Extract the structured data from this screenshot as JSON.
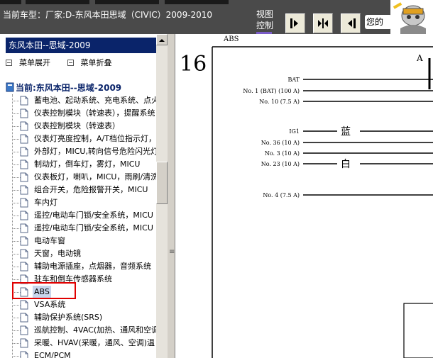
{
  "window": {
    "vehicle_title": "当前车型：厂家:D-东风本田思域（CIVIC）2009-2010",
    "view_label": "视图控制",
    "help_text": "您的"
  },
  "icons": [
    "single-page-icon",
    "split-view-icon",
    "back-icon",
    "mascot-icon",
    "doc-icon"
  ],
  "left_panel": {
    "header": "东风本田--思域-2009",
    "expand_label": "菜单展开",
    "collapse_label": "菜单折叠",
    "root_label": "当前:东风本田--思域-2009",
    "items": [
      "蓄电池、起动系统、充电系统、点火",
      "仪表控制模块（转速表），提醒系统",
      "仪表控制模块（转速表）",
      "仪表灯亮度控制，A/T档位指示灯，",
      "外部灯，MICU,转向信号危险闪光灯",
      "制动灯，倒车灯，雾灯，MICU",
      "仪表板灯，喇叭，MICU，雨刷/清洗",
      "组合开关，危险报警开关，MICU",
      "车内灯",
      "遥控/电动车门锁/安全系统，MICU",
      "遥控/电动车门锁/安全系统，MICU",
      "电动车窗",
      "天窗，电动镜",
      "辅助电源插座，点烟器，音频系统",
      "驻车和倒车传感器系统",
      "ABS",
      "VSA系统",
      "辅助保护系统(SRS)",
      "巡航控制、4VAC(加热、通风和空调",
      "采暖、HVAV(采暖，通风、空调)温",
      "ECM/PCM"
    ],
    "selected_index": 15
  },
  "diagram": {
    "corner_label": "ABS",
    "page_number": "16",
    "column_letter": "A",
    "rows": [
      {
        "label": "BAT",
        "wire": ""
      },
      {
        "label": "No. 1 (BAT) (100 A)",
        "wire": ""
      },
      {
        "label": "No. 10 (7.5 A)",
        "wire": ""
      },
      {
        "label": "IG1",
        "wire": "蓝"
      },
      {
        "label": "No. 36 (10 A)",
        "wire": ""
      },
      {
        "label": "No. 3 (10 A)",
        "wire": ""
      },
      {
        "label": "No. 23 (10 A)",
        "wire": "白"
      },
      {
        "label": "No. 4 (7.5 A)",
        "wire": ""
      }
    ]
  }
}
